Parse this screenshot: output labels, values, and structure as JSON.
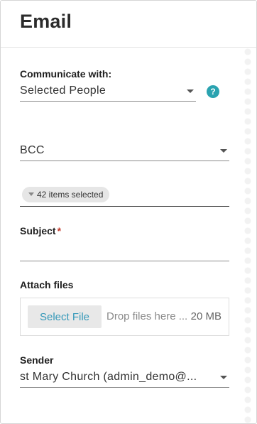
{
  "header": {
    "title": "Email"
  },
  "communicate": {
    "label": "Communicate with:",
    "value": "Selected People",
    "help_icon": "question-mark-icon",
    "help_glyph": "?"
  },
  "bcc": {
    "value": "BCC"
  },
  "recipients": {
    "chip_label": "42 items selected"
  },
  "subject": {
    "label": "Subject",
    "required_mark": "*",
    "value": ""
  },
  "attach": {
    "label": "Attach files",
    "button_label": "Select File",
    "drop_text": "Drop files here ...",
    "max_size": "20 MB"
  },
  "sender": {
    "label": "Sender",
    "value": "st Mary Church (admin_demo@..."
  },
  "colors": {
    "accent": "#2aa3b0",
    "link": "#3498b9",
    "required": "#c0392b"
  }
}
